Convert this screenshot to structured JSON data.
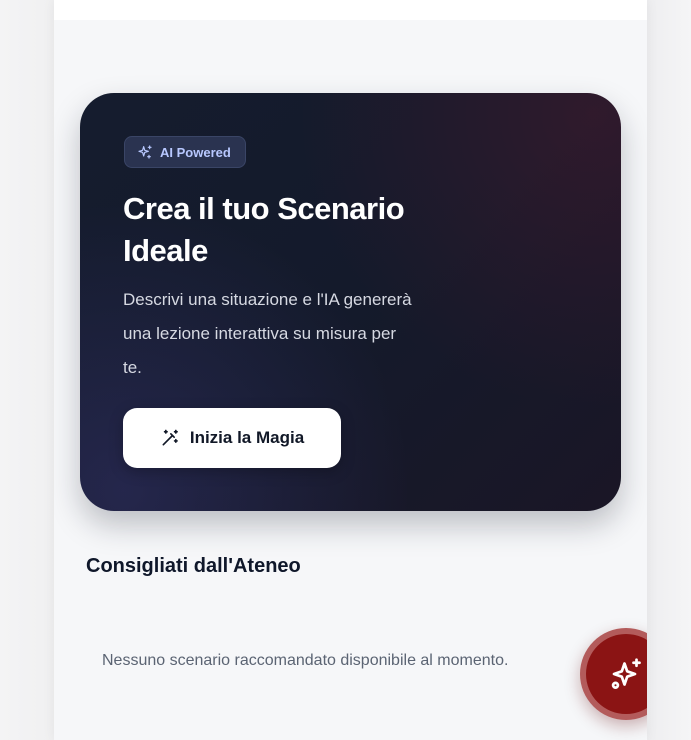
{
  "hero": {
    "badge": {
      "label": "AI Powered",
      "icon": "sparkles-icon"
    },
    "title": "Crea il tuo Scenario Ideale",
    "description": "Descrivi una situazione e l'IA genererà una lezione interattiva su misura per te.",
    "cta": {
      "label": "Inizia la Magia",
      "icon": "magic-wand-icon"
    }
  },
  "recommended": {
    "title": "Consigliati dall'Ateneo",
    "empty_message": "Nessuno scenario raccomandato disponibile al momento."
  },
  "fab": {
    "icon": "sparkles-icon"
  },
  "colors": {
    "hero_bg": "#151c2e",
    "badge_text": "#b8c8ff",
    "fab_bg": "#8b1414",
    "page_bg": "#f6f7f9"
  }
}
